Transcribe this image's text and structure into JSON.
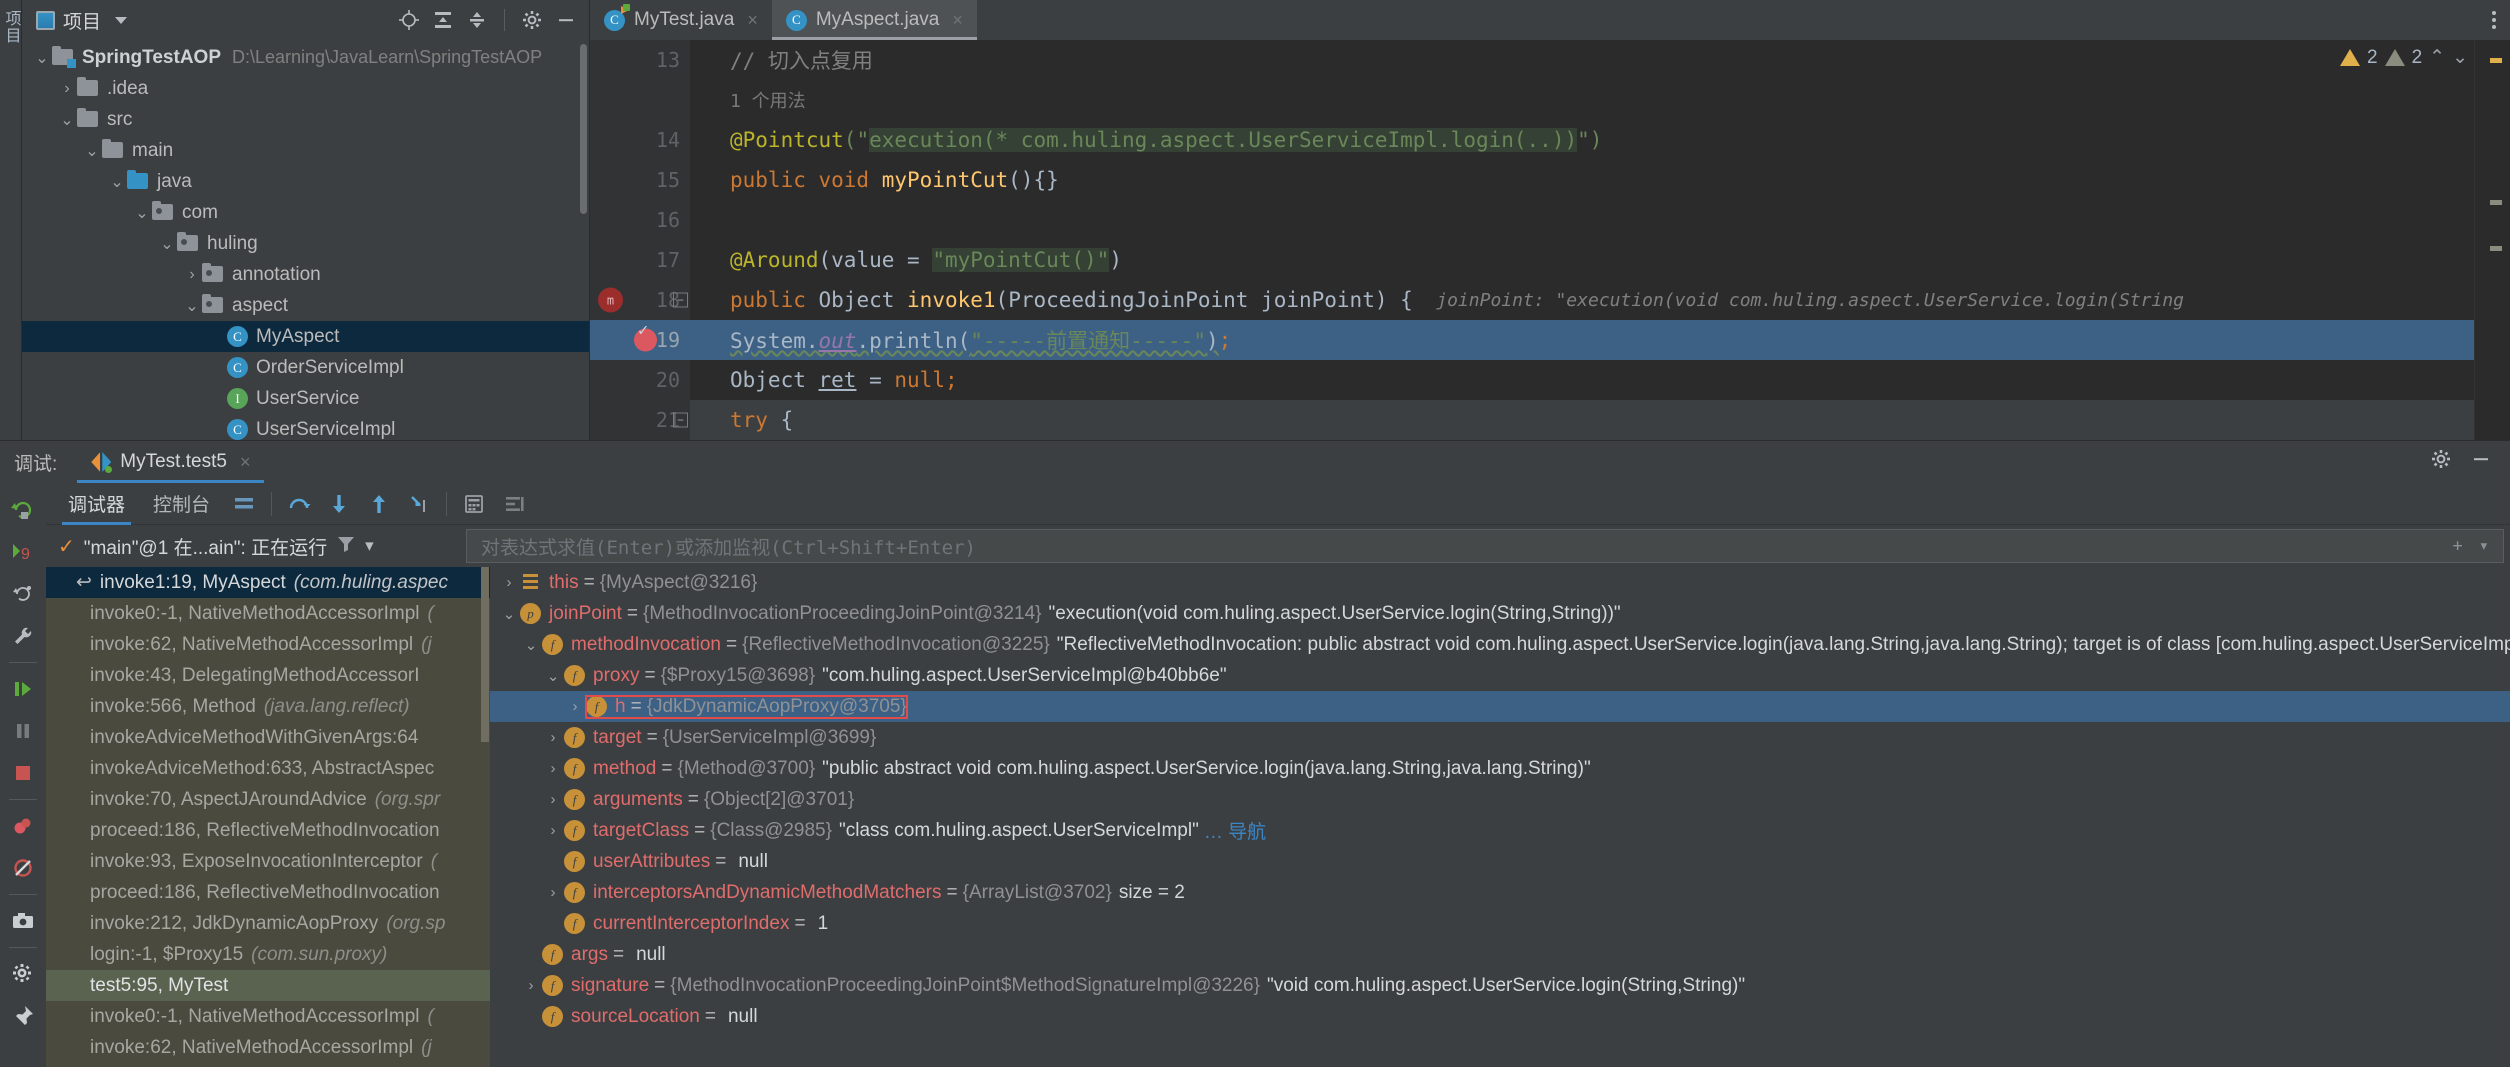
{
  "ide": {
    "project_panel": {
      "title": "项目",
      "title_icon": "project-icon",
      "header_icons": [
        "locate-icon",
        "collapse-all-icon",
        "expand-selection-icon",
        "gear-icon",
        "minimize-icon"
      ],
      "tree": [
        {
          "indent": 0,
          "twisty": "v",
          "icon": "module-folder",
          "label": "SpringTestAOP",
          "bold": true,
          "path": "D:\\Learning\\JavaLearn\\SpringTestAOP",
          "selected": false
        },
        {
          "indent": 1,
          "twisty": ">",
          "icon": "folder",
          "label": ".idea",
          "bold": false,
          "path": "",
          "selected": false
        },
        {
          "indent": 1,
          "twisty": "v",
          "icon": "folder",
          "label": "src",
          "bold": false,
          "path": "",
          "selected": false
        },
        {
          "indent": 2,
          "twisty": "v",
          "icon": "folder",
          "label": "main",
          "bold": false,
          "path": "",
          "selected": false
        },
        {
          "indent": 3,
          "twisty": "v",
          "icon": "source-folder",
          "label": "java",
          "bold": false,
          "path": "",
          "selected": false
        },
        {
          "indent": 4,
          "twisty": "v",
          "icon": "package-folder",
          "label": "com",
          "bold": false,
          "path": "",
          "selected": false
        },
        {
          "indent": 5,
          "twisty": "v",
          "icon": "package-folder",
          "label": "huling",
          "bold": false,
          "path": "",
          "selected": false
        },
        {
          "indent": 6,
          "twisty": ">",
          "icon": "package-folder",
          "label": "annotation",
          "bold": false,
          "path": "",
          "selected": false
        },
        {
          "indent": 6,
          "twisty": "v",
          "icon": "package-folder",
          "label": "aspect",
          "bold": false,
          "path": "",
          "selected": false
        },
        {
          "indent": 7,
          "twisty": "",
          "icon": "class",
          "label": "MyAspect",
          "bold": false,
          "path": "",
          "selected": true
        },
        {
          "indent": 7,
          "twisty": "",
          "icon": "class",
          "label": "OrderServiceImpl",
          "bold": false,
          "path": "",
          "selected": false
        },
        {
          "indent": 7,
          "twisty": "",
          "icon": "interface",
          "label": "UserService",
          "bold": false,
          "path": "",
          "selected": false
        },
        {
          "indent": 7,
          "twisty": "",
          "icon": "class",
          "label": "UserServiceImpl",
          "bold": false,
          "path": "",
          "selected": false
        }
      ]
    },
    "editor": {
      "tabs": [
        {
          "label": "MyTest.java",
          "icon": "java-class-runnable-icon",
          "active": false
        },
        {
          "label": "MyAspect.java",
          "icon": "java-class-icon",
          "active": true
        }
      ],
      "inspection": {
        "warning_count": "2",
        "weak_warning_count": "2"
      },
      "lines": [
        {
          "num": "13",
          "kind": "comment",
          "text": "// 切入点复用"
        },
        {
          "num": "",
          "kind": "usage-hint",
          "text": "1 个用法"
        },
        {
          "num": "14",
          "kind": "pointcut",
          "annotation": "@Pointcut",
          "quote_open": "(\"",
          "highlight": "execution(* com.huling.aspect.UserServiceImpl.login(..))",
          "quote_close": "\")"
        },
        {
          "num": "15",
          "kind": "method-sig",
          "modifiers": "public void ",
          "name": "myPointCut",
          "tail": "(){}"
        },
        {
          "num": "16",
          "kind": "blank",
          "text": ""
        },
        {
          "num": "17",
          "kind": "around",
          "annotation": "@Around",
          "mid": "(value = ",
          "highlight": "\"myPointCut()\"",
          "tail": ")"
        },
        {
          "num": "18",
          "kind": "invoke-sig",
          "modifiers": "public ",
          "ret": "Object ",
          "name": "invoke1",
          "params": "(ProceedingJoinPoint joinPoint) { ",
          "hint_label": "joinPoint:",
          "hint_value": "\"execution(void com.huling.aspect.UserService.login(String"
        },
        {
          "num": "19",
          "kind": "println",
          "text": "System.out.println(\"-----前置通知-----\");",
          "highlighted": true
        },
        {
          "num": "20",
          "kind": "objret",
          "text": "Object ret = null;"
        },
        {
          "num": "21",
          "kind": "try",
          "text": "try {"
        }
      ]
    }
  },
  "debug": {
    "panel_label": "调试:",
    "session_tab": {
      "label": "MyTest.test5",
      "close": "×"
    },
    "header_icons": [
      "settings-icon",
      "minimize-icon"
    ],
    "toolbar": {
      "tabs": [
        {
          "label": "调试器",
          "active": true
        },
        {
          "label": "控制台",
          "active": false
        }
      ],
      "icons": [
        "layout-icon",
        "step-over-icon",
        "step-into-icon",
        "step-out-icon",
        "run-to-cursor-icon",
        "evaluate-icon",
        "mute-breakpoints-icon"
      ]
    },
    "sidebar_icons": [
      "rerun-icon",
      "breakpoints-count-icon",
      "restore-layout-icon",
      "settings-wrench-icon",
      "resume-icon",
      "pause-icon",
      "stop-icon",
      "view-breakpoints-icon",
      "mute-breakpoints-icon",
      "camera-icon",
      "settings-gear-icon",
      "pin-icon"
    ],
    "breakpoint_count": "9",
    "thread": {
      "status_icon": "check-icon",
      "text": "\"main\"@1 在...ain\": 正在运行",
      "filter_icon": "filter-icon",
      "dropdown_icon": "chevron-down-icon"
    },
    "expression_field": {
      "placeholder": "对表达式求值(Enter)或添加监视(Ctrl+Shift+Enter)",
      "value": ""
    },
    "frames": [
      {
        "text": "invoke1:19, MyAspect",
        "pkg": "(com.huling.aspec",
        "state": "selected"
      },
      {
        "text": "invoke0:-1, NativeMethodAccessorImpl",
        "pkg": "(",
        "state": "normal"
      },
      {
        "text": "invoke:62, NativeMethodAccessorImpl",
        "pkg": "(j",
        "state": "normal"
      },
      {
        "text": "invoke:43, DelegatingMethodAccessorI",
        "pkg": "",
        "state": "normal"
      },
      {
        "text": "invoke:566, Method",
        "pkg": "(java.lang.reflect)",
        "state": "normal"
      },
      {
        "text": "invokeAdviceMethodWithGivenArgs:64",
        "pkg": "",
        "state": "normal"
      },
      {
        "text": "invokeAdviceMethod:633, AbstractAspec",
        "pkg": "",
        "state": "normal"
      },
      {
        "text": "invoke:70, AspectJAroundAdvice",
        "pkg": "(org.spr",
        "state": "normal"
      },
      {
        "text": "proceed:186, ReflectiveMethodInvocation",
        "pkg": "",
        "state": "normal"
      },
      {
        "text": "invoke:93, ExposeInvocationInterceptor",
        "pkg": "(",
        "state": "normal"
      },
      {
        "text": "proceed:186, ReflectiveMethodInvocation",
        "pkg": "",
        "state": "normal"
      },
      {
        "text": "invoke:212, JdkDynamicAopProxy",
        "pkg": "(org.sp",
        "state": "normal"
      },
      {
        "text": "login:-1, $Proxy15",
        "pkg": "(com.sun.proxy)",
        "state": "normal"
      },
      {
        "text": "test5:95, MyTest",
        "pkg": "",
        "state": "current"
      },
      {
        "text": "invoke0:-1, NativeMethodAccessorImpl",
        "pkg": "(",
        "state": "normal"
      },
      {
        "text": "invoke:62, NativeMethodAccessorImpl",
        "pkg": "(j",
        "state": "normal"
      }
    ],
    "variables": [
      {
        "indent": 0,
        "twisty": ">",
        "icon": "this-icon",
        "name": "this",
        "eq": "=",
        "ref": "{MyAspect@3216}",
        "str": "",
        "extra": "",
        "selected": false,
        "boxed": false
      },
      {
        "indent": 0,
        "twisty": "v",
        "icon": "param-icon",
        "name": "joinPoint",
        "eq": "=",
        "ref": "{MethodInvocationProceedingJoinPoint@3214}",
        "str": "\"execution(void com.huling.aspect.UserService.login(String,String))\"",
        "extra": "",
        "selected": false,
        "boxed": false
      },
      {
        "indent": 1,
        "twisty": "v",
        "icon": "field-icon",
        "name": "methodInvocation",
        "eq": "=",
        "ref": "{ReflectiveMethodInvocation@3225}",
        "str": "\"ReflectiveMethodInvocation: public abstract void com.huling.aspect.UserService.login(java.lang.String,java.lang.String); target is of class [com.huling.aspect.UserServiceImpl",
        "extra": "",
        "selected": false,
        "boxed": false
      },
      {
        "indent": 2,
        "twisty": "v",
        "icon": "field-icon",
        "name": "proxy",
        "eq": "=",
        "ref": "{$Proxy15@3698}",
        "str": "\"com.huling.aspect.UserServiceImpl@b40bb6e\"",
        "extra": "",
        "selected": false,
        "boxed": false
      },
      {
        "indent": 3,
        "twisty": ">",
        "icon": "field-icon",
        "name": "h",
        "eq": "=",
        "ref": "{JdkDynamicAopProxy@3705}",
        "str": "",
        "extra": "",
        "selected": true,
        "boxed": true
      },
      {
        "indent": 2,
        "twisty": ">",
        "icon": "field-icon",
        "name": "target",
        "eq": "=",
        "ref": "{UserServiceImpl@3699}",
        "str": "",
        "extra": "",
        "selected": false,
        "boxed": false
      },
      {
        "indent": 2,
        "twisty": ">",
        "icon": "field-icon",
        "name": "method",
        "eq": "=",
        "ref": "{Method@3700}",
        "str": "\"public abstract void com.huling.aspect.UserService.login(java.lang.String,java.lang.String)\"",
        "extra": "",
        "selected": false,
        "boxed": false
      },
      {
        "indent": 2,
        "twisty": ">",
        "icon": "field-icon",
        "name": "arguments",
        "eq": "=",
        "ref": "{Object[2]@3701}",
        "str": "",
        "extra": "",
        "selected": false,
        "boxed": false
      },
      {
        "indent": 2,
        "twisty": ">",
        "icon": "field-icon",
        "name": "targetClass",
        "eq": "=",
        "ref": "{Class@2985}",
        "str": "\"class com.huling.aspect.UserServiceImpl\"",
        "extra": "… 导航",
        "selected": false,
        "boxed": false
      },
      {
        "indent": 2,
        "twisty": "",
        "icon": "field-icon",
        "name": "userAttributes",
        "eq": "=",
        "ref": "",
        "str": "null",
        "extra": "",
        "selected": false,
        "boxed": false
      },
      {
        "indent": 2,
        "twisty": ">",
        "icon": "field-icon",
        "name": "interceptorsAndDynamicMethodMatchers",
        "eq": "=",
        "ref": "{ArrayList@3702}",
        "str": "size = 2",
        "extra": "",
        "selected": false,
        "boxed": false
      },
      {
        "indent": 2,
        "twisty": "",
        "icon": "field-icon",
        "name": "currentInterceptorIndex",
        "eq": "=",
        "ref": "",
        "str": "1",
        "extra": "",
        "selected": false,
        "boxed": false
      },
      {
        "indent": 1,
        "twisty": "",
        "icon": "field-icon",
        "name": "args",
        "eq": "=",
        "ref": "",
        "str": "null",
        "extra": "",
        "selected": false,
        "boxed": false
      },
      {
        "indent": 1,
        "twisty": ">",
        "icon": "field-icon",
        "name": "signature",
        "eq": "=",
        "ref": "{MethodInvocationProceedingJoinPoint$MethodSignatureImpl@3226}",
        "str": "\"void com.huling.aspect.UserService.login(String,String)\"",
        "extra": "",
        "selected": false,
        "boxed": false
      },
      {
        "indent": 1,
        "twisty": "",
        "icon": "field-icon",
        "name": "sourceLocation",
        "eq": "=",
        "ref": "",
        "str": "null",
        "extra": "",
        "selected": false,
        "boxed": false
      }
    ]
  },
  "colors": {
    "bg": "#3c3f41",
    "editor_bg": "#2b2b2b",
    "selection_blue": "#3d6185",
    "tree_selection": "#0d293e",
    "frames_bg": "#4b4a3f",
    "accent_blue": "#3d86c6",
    "string_green": "#6a8759",
    "keyword_orange": "#cc7832",
    "annotation_yellow": "#bbb529",
    "method_yellow": "#ffc66d",
    "var_red": "#e06c6c",
    "highlight_red": "#e04b4b"
  }
}
